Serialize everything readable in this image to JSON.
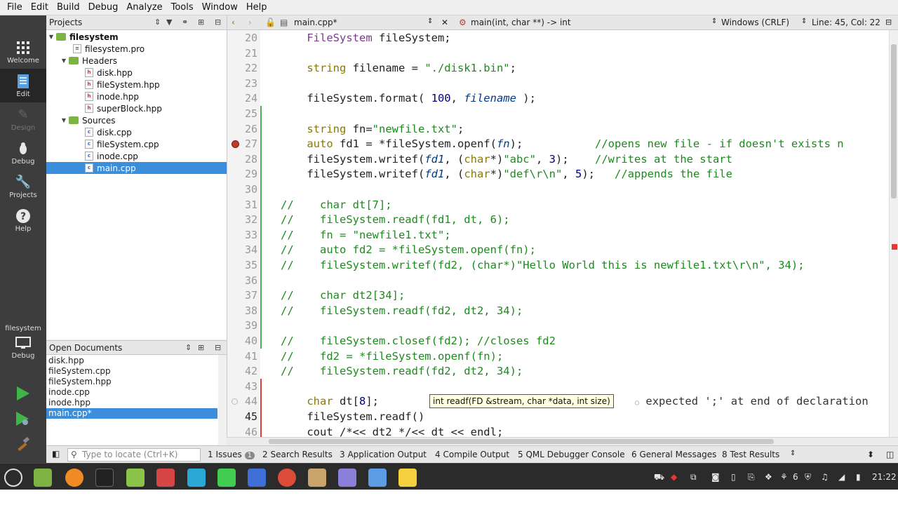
{
  "menu": [
    "File",
    "Edit",
    "Build",
    "Debug",
    "Analyze",
    "Tools",
    "Window",
    "Help"
  ],
  "modes": [
    {
      "label": "Welcome",
      "icon": "grid-icon"
    },
    {
      "label": "Edit",
      "icon": "document-icon"
    },
    {
      "label": "Design",
      "icon": "pen-icon"
    },
    {
      "label": "Debug",
      "icon": "bug-icon"
    },
    {
      "label": "Projects",
      "icon": "wrench-icon"
    },
    {
      "label": "Help",
      "icon": "help-icon"
    }
  ],
  "kit": {
    "project": "filesystem",
    "mode": "Debug"
  },
  "projects_panel": {
    "title": "Projects"
  },
  "tree": [
    {
      "label": "filesystem",
      "kind": "project",
      "depth": 0,
      "bold": true
    },
    {
      "label": "filesystem.pro",
      "kind": "file",
      "depth": 1
    },
    {
      "label": "Headers",
      "kind": "folder",
      "depth": 1
    },
    {
      "label": "disk.hpp",
      "kind": "file",
      "depth": 2
    },
    {
      "label": "fileSystem.hpp",
      "kind": "file",
      "depth": 2
    },
    {
      "label": "inode.hpp",
      "kind": "file",
      "depth": 2
    },
    {
      "label": "superBlock.hpp",
      "kind": "file",
      "depth": 2
    },
    {
      "label": "Sources",
      "kind": "folder",
      "depth": 1
    },
    {
      "label": "disk.cpp",
      "kind": "file",
      "depth": 2
    },
    {
      "label": "fileSystem.cpp",
      "kind": "file",
      "depth": 2
    },
    {
      "label": "inode.cpp",
      "kind": "file",
      "depth": 2
    },
    {
      "label": "main.cpp",
      "kind": "file",
      "depth": 2,
      "selected": true
    }
  ],
  "open_documents": {
    "title": "Open Documents",
    "items": [
      "disk.hpp",
      "fileSystem.cpp",
      "fileSystem.hpp",
      "inode.cpp",
      "inode.hpp",
      "main.cpp*"
    ],
    "selected_index": 5
  },
  "editor_toolbar": {
    "file": "main.cpp*",
    "symbol": "main(int, char **) -> int",
    "line_ending": "Windows (CRLF)",
    "position": "Line: 45, Col: 22"
  },
  "code": {
    "current_line": 45,
    "breakpoint_line": 27,
    "lines": [
      {
        "n": "20",
        "t": "    FileSystem fileSystem;"
      },
      {
        "n": "21",
        "t": ""
      },
      {
        "n": "22",
        "t": "    string filename = \"./disk1.bin\";"
      },
      {
        "n": "23",
        "t": ""
      },
      {
        "n": "24",
        "t": "    fileSystem.format( 100, filename );"
      },
      {
        "n": "25",
        "t": ""
      },
      {
        "n": "26",
        "t": "    string fn=\"newfile.txt\";"
      },
      {
        "n": "27",
        "t": "    auto fd1 = *fileSystem.openf(fn);           //opens new file - if doesn't exists n"
      },
      {
        "n": "28",
        "t": "    fileSystem.writef(fd1, (char*)\"abc\", 3);    //writes at the start"
      },
      {
        "n": "29",
        "t": "    fileSystem.writef(fd1, (char*)\"def\\r\\n\", 5);   //appends the file"
      },
      {
        "n": "30",
        "t": ""
      },
      {
        "n": "31",
        "t": "//    char dt[7];"
      },
      {
        "n": "32",
        "t": "//    fileSystem.readf(fd1, dt, 6);"
      },
      {
        "n": "33",
        "t": "//    fn = \"newfile1.txt\";"
      },
      {
        "n": "34",
        "t": "//    auto fd2 = *fileSystem.openf(fn);"
      },
      {
        "n": "35",
        "t": "//    fileSystem.writef(fd2, (char*)\"Hello World this is newfile1.txt\\r\\n\", 34);"
      },
      {
        "n": "36",
        "t": ""
      },
      {
        "n": "37",
        "t": "//    char dt2[34];"
      },
      {
        "n": "38",
        "t": "//    fileSystem.readf(fd2, dt2, 34);"
      },
      {
        "n": "39",
        "t": ""
      },
      {
        "n": "40",
        "t": "//    fileSystem.closef(fd2); //closes fd2"
      },
      {
        "n": "41",
        "t": "//    fd2 = *fileSystem.openf(fn);"
      },
      {
        "n": "42",
        "t": "//    fileSystem.readf(fd2, dt2, 34);"
      },
      {
        "n": "43",
        "t": ""
      },
      {
        "n": "44",
        "t": "    char dt[8];"
      },
      {
        "n": "45",
        "t": "    fileSystem.readf()"
      },
      {
        "n": "46",
        "t": "    cout /*<< dt2 */<< dt << endl;"
      }
    ]
  },
  "tooltip": "int readf(FD &stream, char *data, int size)",
  "diagnostic": "expected ';' at end of declaration",
  "output_bar": {
    "locate_placeholder": "Type to locate (Ctrl+K)",
    "panes": [
      {
        "num": "1",
        "label": "Issues",
        "badge": "1"
      },
      {
        "num": "2",
        "label": "Search Results"
      },
      {
        "num": "3",
        "label": "Application Output"
      },
      {
        "num": "4",
        "label": "Compile Output"
      },
      {
        "num": "5",
        "label": "QML Debugger Console"
      },
      {
        "num": "6",
        "label": "General Messages"
      },
      {
        "num": "8",
        "label": "Test Results"
      }
    ]
  },
  "taskbar": {
    "apps": [
      "mint-menu-icon",
      "show-desktop-icon",
      "firefox-icon",
      "terminal-icon",
      "files-icon",
      "mailer-icon",
      "transfer-icon",
      "qt-creator-icon",
      "text-editor-icon",
      "chrome-icon",
      "archive-icon",
      "notes-icon",
      "screenshot-icon",
      "sticky-notes-icon"
    ],
    "workspace": "6",
    "time": "21:22"
  },
  "colors": {
    "selection": "#3a8edb",
    "modebar": "#3d3d3d",
    "comment": "#1c8a1c",
    "keyword": "#8a7a00"
  }
}
